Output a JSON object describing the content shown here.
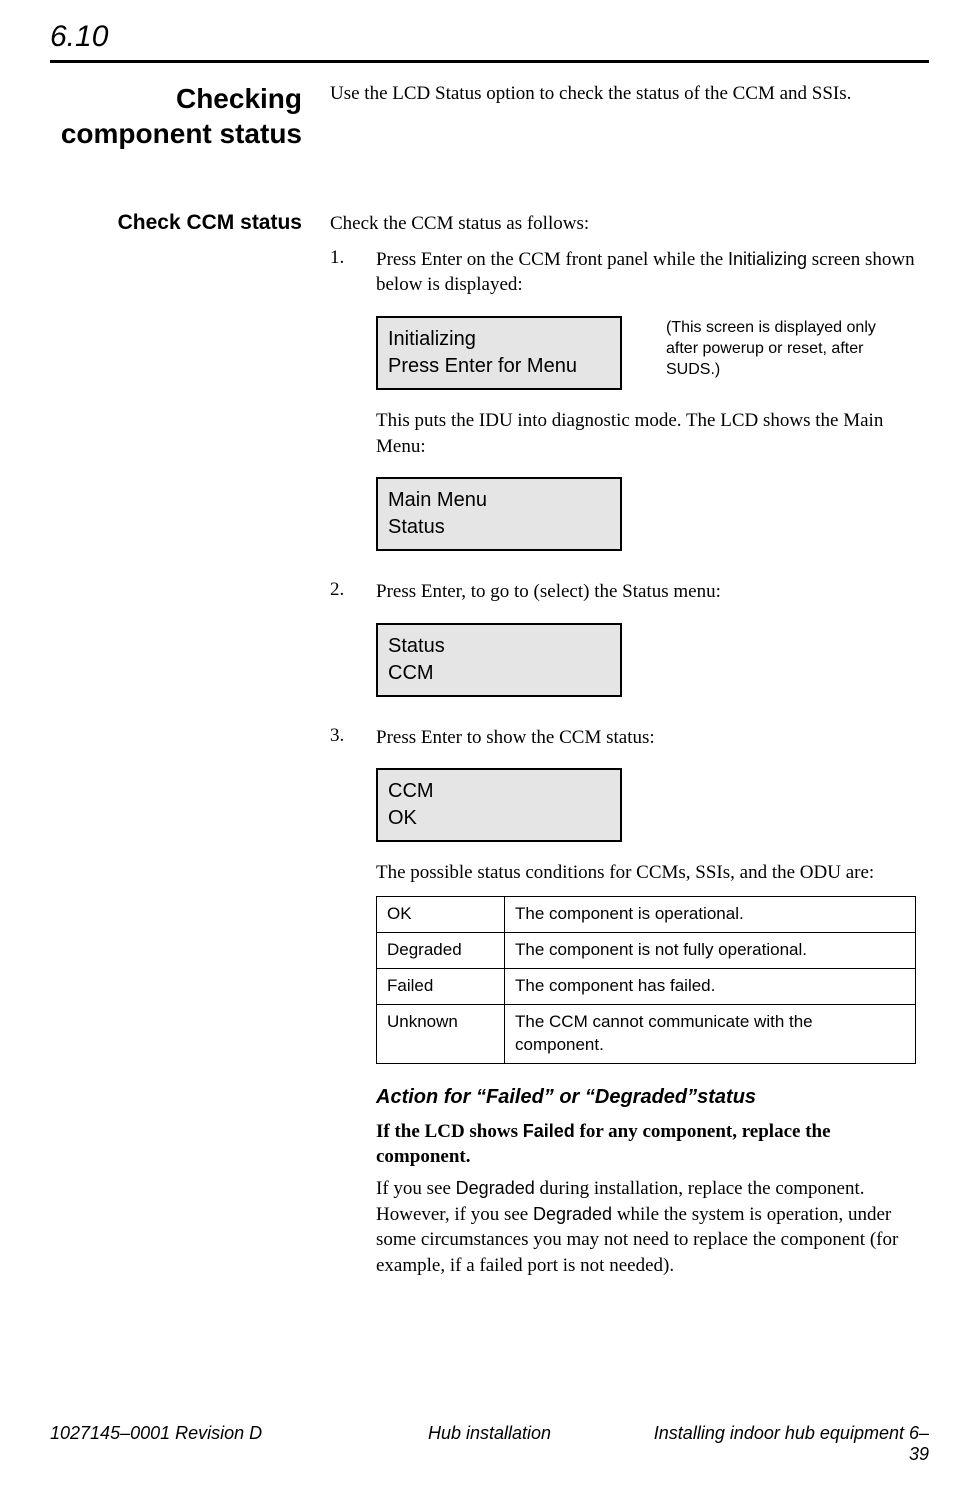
{
  "section_number": "6.10",
  "heading_left": "Checking component status",
  "heading_intro": "Use the LCD Status option to check the status of the CCM and SSIs.",
  "sub_left": "Check CCM status",
  "sub_intro": "Check the CCM status as follows:",
  "step1": {
    "num": "1.",
    "text_a": "Press Enter on the CCM front panel while the ",
    "text_b": "Initializing",
    "text_c": " screen shown below is displayed:",
    "lcd_line1": "Initializing",
    "lcd_line2": "Press Enter for Menu",
    "note": "(This screen is displayed only after powerup or reset, after SUDS.)",
    "after": "This puts the IDU into diagnostic mode. The LCD shows the Main Menu:",
    "lcd2_line1": "Main Menu",
    "lcd2_line2": "Status"
  },
  "step2": {
    "num": "2.",
    "text": "Press Enter, to go to (select) the Status menu:",
    "lcd_line1": "Status",
    "lcd_line2": "CCM"
  },
  "step3": {
    "num": "3.",
    "text": "Press Enter to show the CCM status:",
    "lcd_line1": "CCM",
    "lcd_line2": "OK",
    "after": "The possible status conditions for CCMs, SSIs, and the ODU are:"
  },
  "status_table": [
    {
      "k": "OK",
      "v": "The component is operational."
    },
    {
      "k": "Degraded",
      "v": "The component is not fully operational."
    },
    {
      "k": "Failed",
      "v": "The component has failed."
    },
    {
      "k": "Unknown",
      "v": "The CCM cannot communicate with the component."
    }
  ],
  "action": {
    "head": "Action for “Failed” or “Degraded”status",
    "p1_a": "If the LCD shows ",
    "p1_b": "Failed",
    "p1_c": " for any component, replace the component.",
    "p2_a": "If you see ",
    "p2_b": "Degraded",
    "p2_c": " during installation, replace the component. However, if you see ",
    "p2_d": "Degraded",
    "p2_e": " while the system is operation, under some circumstances you may not need to replace the component (for example, if a failed port is not needed)."
  },
  "footer": {
    "left": "1027145–0001  Revision D",
    "center": "Hub installation",
    "right": "Installing indoor hub equipment   6–39"
  }
}
